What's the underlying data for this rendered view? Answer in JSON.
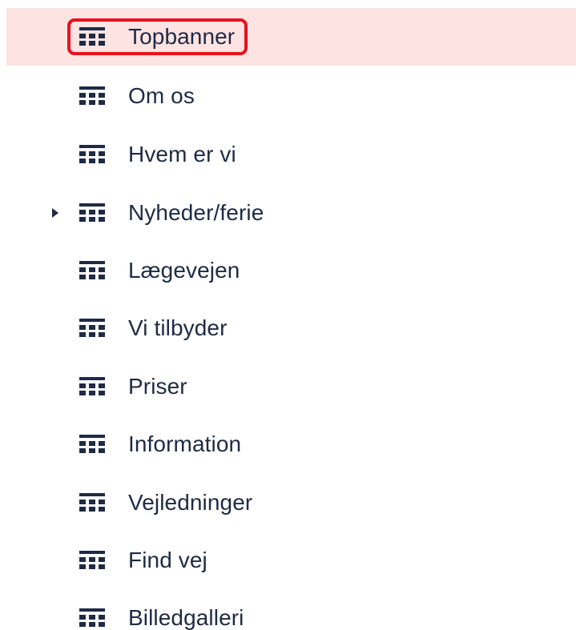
{
  "tree": {
    "selected_index": 0,
    "items": [
      {
        "label": "Topbanner",
        "has_children": false,
        "icon": "grid-layout-icon"
      },
      {
        "label": "Om os",
        "has_children": false,
        "icon": "grid-layout-icon"
      },
      {
        "label": "Hvem er vi",
        "has_children": false,
        "icon": "grid-layout-icon"
      },
      {
        "label": "Nyheder/ferie",
        "has_children": true,
        "icon": "grid-layout-icon"
      },
      {
        "label": "Lægevejen",
        "has_children": false,
        "icon": "grid-layout-icon"
      },
      {
        "label": "Vi tilbyder",
        "has_children": false,
        "icon": "grid-layout-icon"
      },
      {
        "label": "Priser",
        "has_children": false,
        "icon": "grid-layout-icon"
      },
      {
        "label": "Information",
        "has_children": false,
        "icon": "grid-layout-icon"
      },
      {
        "label": "Vejledninger",
        "has_children": false,
        "icon": "grid-layout-icon"
      },
      {
        "label": "Find vej",
        "has_children": false,
        "icon": "grid-layout-icon"
      },
      {
        "label": "Billedgalleri",
        "has_children": false,
        "icon": "grid-layout-icon"
      }
    ]
  },
  "colors": {
    "text": "#1f2a44",
    "selected_background": "#fde3e2",
    "selected_border": "#e8121e"
  }
}
